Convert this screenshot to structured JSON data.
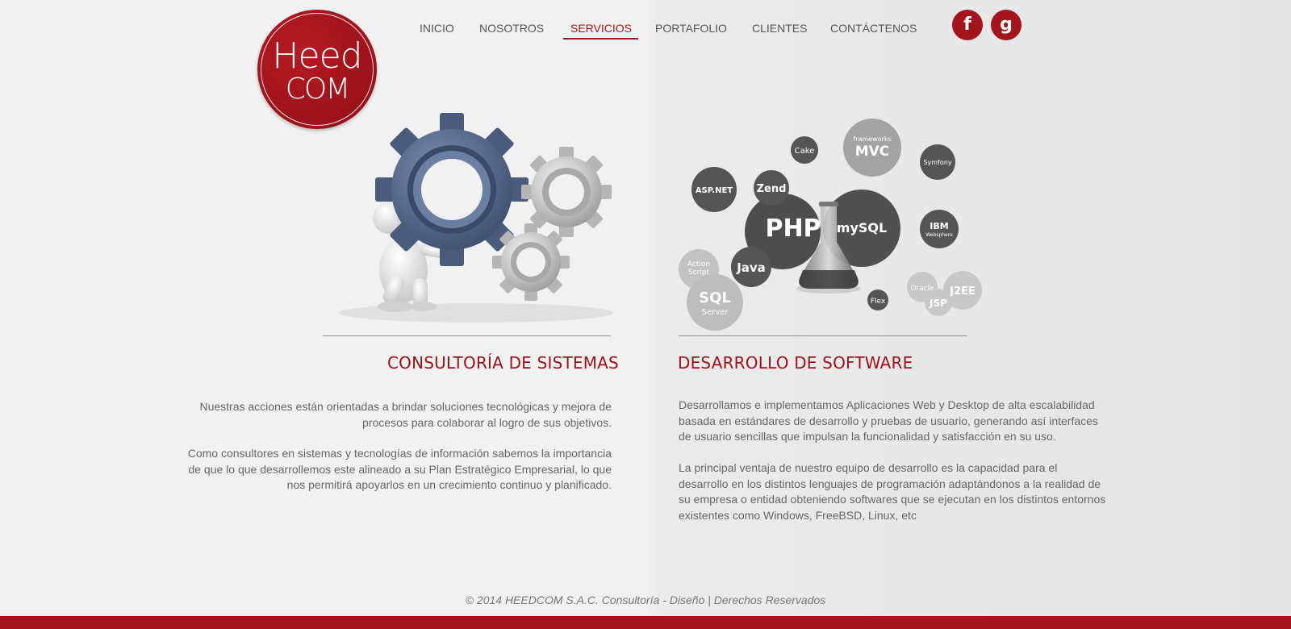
{
  "logo": {
    "line1": "Heed",
    "line2": "COM"
  },
  "nav": {
    "items": [
      {
        "label": "INICIO"
      },
      {
        "label": "NOSOTROS"
      },
      {
        "label": "SERVICIOS",
        "active": true
      },
      {
        "label": "PORTAFOLIO"
      },
      {
        "label": "CLIENTES"
      },
      {
        "label": "CONTÁCTENOS"
      }
    ]
  },
  "social": {
    "facebook": "f",
    "google": "g"
  },
  "colors": {
    "brand_red": "#a4141c",
    "text_gray": "#666666"
  },
  "tech_bubbles": {
    "php": "PHP",
    "mysql": "mySQL",
    "java": "Java",
    "zend": "Zend",
    "cake": "Cake",
    "mvc_small": "frameworks",
    "mvc_big": "MVC",
    "symfony": "Symfony",
    "aspnet": "ASP.NET",
    "ibm": "IBM",
    "websphere": "Websphere",
    "action1": "Action",
    "action2": "Script",
    "sql": "SQL",
    "server": "Server",
    "flex": "Flex",
    "oracle": "Oracle",
    "j2ee": "J2EE",
    "jsp": "JSP"
  },
  "consultoria": {
    "title": "CONSULTORÍA DE SISTEMAS",
    "p1": "Nuestras acciones están orientadas a brindar soluciones tecnológicas y mejora de procesos para colaborar al logro de sus objetivos.",
    "p2": "Como consultores en sistemas y tecnologías de información sabemos la importancia de que lo que desarrollemos este alineado a su Plan Estratégico Empresarial, lo que nos permitirá apoyarlos en un crecimiento continuo y planificado."
  },
  "desarrollo": {
    "title": "DESARROLLO DE SOFTWARE",
    "p1": "Desarrollamos e implementamos Aplicaciones Web y Desktop de alta escalabilidad basada en estándares de desarrollo y pruebas de usuario, generando así interfaces de usuario sencillas que impulsan la funcionalidad y satisfacción en su uso.",
    "p2": "La principal ventaja de nuestro equipo de desarrollo es la capacidad para el desarrollo en los distintos lenguajes de programación adaptándonos a la realidad de su empresa o entidad obteniendo softwares que se ejecutan en los distintos entornos existentes como Windows, FreeBSD, Linux, etc"
  },
  "footer": {
    "text": "© 2014 HEEDCOM S.A.C. Consultoría - Diseño | Derechos Reservados"
  }
}
